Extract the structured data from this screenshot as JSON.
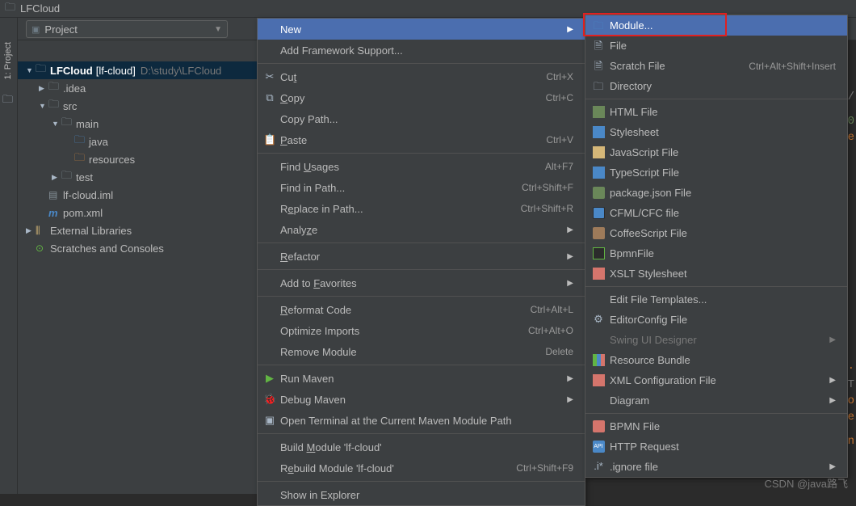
{
  "title": "LFCloud",
  "toolbar": {
    "project_label": "Project"
  },
  "side_tab": "1: Project",
  "tree": {
    "root": "LFCloud",
    "root_suffix": "[lf-cloud]",
    "root_path": "D:\\study\\LFCloud",
    "items": [
      {
        "label": ".idea",
        "icon": "folder"
      },
      {
        "label": "src",
        "icon": "folder"
      },
      {
        "label": "main",
        "icon": "folder"
      },
      {
        "label": "java",
        "icon": "folder-blue"
      },
      {
        "label": "resources",
        "icon": "folder-orange"
      },
      {
        "label": "test",
        "icon": "folder"
      },
      {
        "label": "lf-cloud.iml",
        "icon": "iml"
      },
      {
        "label": "pom.xml",
        "icon": "pom"
      }
    ],
    "external": "External Libraries",
    "scratches": "Scratches and Consoles"
  },
  "context_menu": [
    {
      "label": "New",
      "sub": true,
      "hl": true
    },
    {
      "label": "Add Framework Support..."
    },
    {
      "sep": true
    },
    {
      "label": "Cut",
      "u": "t",
      "shortcut": "Ctrl+X",
      "icon": "cut"
    },
    {
      "label": "Copy",
      "u": "C",
      "shortcut": "Ctrl+C",
      "icon": "copy"
    },
    {
      "label": "Copy Path..."
    },
    {
      "label": "Paste",
      "u": "P",
      "shortcut": "Ctrl+V",
      "icon": "paste"
    },
    {
      "sep": true
    },
    {
      "label": "Find Usages",
      "u": "U",
      "shortcut": "Alt+F7"
    },
    {
      "label": "Find in Path...",
      "shortcut": "Ctrl+Shift+F"
    },
    {
      "label": "Replace in Path...",
      "u": "e",
      "shortcut": "Ctrl+Shift+R"
    },
    {
      "label": "Analyze",
      "u": "z",
      "sub": true
    },
    {
      "sep": true
    },
    {
      "label": "Refactor",
      "u": "R",
      "sub": true
    },
    {
      "sep": true
    },
    {
      "label": "Add to Favorites",
      "u": "F",
      "sub": true
    },
    {
      "sep": true
    },
    {
      "label": "Reformat Code",
      "u": "R",
      "shortcut": "Ctrl+Alt+L"
    },
    {
      "label": "Optimize Imports",
      "shortcut": "Ctrl+Alt+O"
    },
    {
      "label": "Remove Module",
      "shortcut": "Delete"
    },
    {
      "sep": true
    },
    {
      "label": "Run Maven",
      "icon": "run",
      "sub": true
    },
    {
      "label": "Debug Maven",
      "icon": "debug",
      "sub": true
    },
    {
      "label": "Open Terminal at the Current Maven Module Path",
      "icon": "term"
    },
    {
      "sep": true
    },
    {
      "label": "Build Module 'lf-cloud'",
      "u": "M"
    },
    {
      "label": "Rebuild Module 'lf-cloud'",
      "u": "e",
      "shortcut": "Ctrl+Shift+F9"
    },
    {
      "sep": true
    },
    {
      "label": "Show in Explorer"
    }
  ],
  "submenu": [
    {
      "label": "Module...",
      "icon": "folder-blue",
      "hl": true
    },
    {
      "label": "File",
      "icon": "file"
    },
    {
      "label": "Scratch File",
      "icon": "file",
      "shortcut": "Ctrl+Alt+Shift+Insert"
    },
    {
      "label": "Directory",
      "icon": "folder"
    },
    {
      "sep": true
    },
    {
      "label": "HTML File",
      "icon": "html"
    },
    {
      "label": "Stylesheet",
      "icon": "css"
    },
    {
      "label": "JavaScript File",
      "icon": "js"
    },
    {
      "label": "TypeScript File",
      "icon": "ts"
    },
    {
      "label": "package.json File",
      "icon": "pkg"
    },
    {
      "label": "CFML/CFC file",
      "icon": "cfc"
    },
    {
      "label": "CoffeeScript File",
      "icon": "coffee"
    },
    {
      "label": "BpmnFile",
      "icon": "bpmn"
    },
    {
      "label": "XSLT Stylesheet",
      "icon": "xslt"
    },
    {
      "sep": true
    },
    {
      "label": "Edit File Templates..."
    },
    {
      "label": "EditorConfig File",
      "icon": "gear"
    },
    {
      "label": "Swing UI Designer",
      "dim": true,
      "sub": true
    },
    {
      "label": "Resource Bundle",
      "icon": "res"
    },
    {
      "label": "XML Configuration File",
      "icon": "xml",
      "sub": true
    },
    {
      "label": "Diagram",
      "sub": true
    },
    {
      "sep": true
    },
    {
      "label": "BPMN File",
      "icon": "bpmn2"
    },
    {
      "label": "HTTP Request",
      "icon": "api"
    },
    {
      "label": ".ignore file",
      "icon": "ignore",
      "sub": true
    }
  ],
  "watermark": "CSDN @java路飞"
}
